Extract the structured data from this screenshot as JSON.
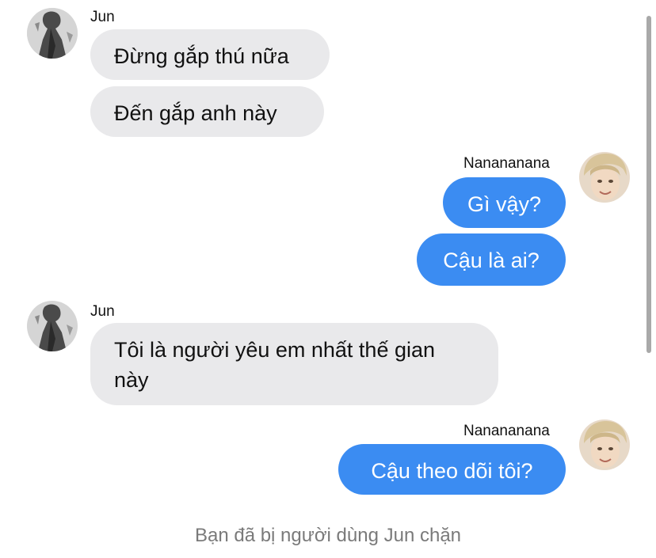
{
  "conversation": {
    "groups": [
      {
        "sender": "Jun",
        "side": "incoming",
        "messages": [
          "Đừng gắp thú nữa",
          "Đến gắp anh này"
        ]
      },
      {
        "sender": "Nanananana",
        "side": "outgoing",
        "messages": [
          "Gì vậy?",
          "Cậu là ai?"
        ]
      },
      {
        "sender": "Jun",
        "side": "incoming",
        "messages": [
          "Tôi là người yêu em nhất thế gian này"
        ]
      },
      {
        "sender": "Nanananana",
        "side": "outgoing",
        "messages": [
          "Cậu theo dõi tôi?"
        ]
      }
    ],
    "status_text": "Bạn đã bị người dùng Jun chặn"
  },
  "colors": {
    "incoming_bubble": "#e9e9eb",
    "outgoing_bubble": "#3b8cf2",
    "status_text": "#7a7a7a"
  },
  "icons": {
    "incoming_avatar": "avatar-jun",
    "outgoing_avatar": "avatar-nanananana"
  }
}
